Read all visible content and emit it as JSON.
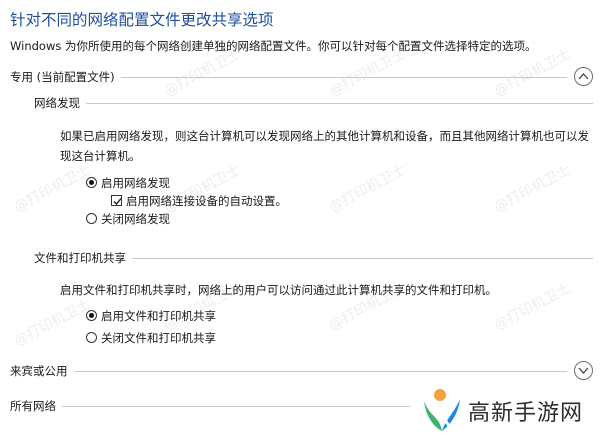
{
  "page": {
    "title": "针对不同的网络配置文件更改共享选项",
    "description": "Windows 为你所使用的每个网络创建单独的网络配置文件。你可以针对每个配置文件选择特定的选项。"
  },
  "sections": {
    "private": {
      "label": "专用 (当前配置文件)",
      "expanded": true,
      "chevron_icon": "chevron-up-icon",
      "network_discovery": {
        "label": "网络发现",
        "description": "如果已启用网络发现，则这台计算机可以发现网络上的其他计算机和设备，而且其他网络计算机也可以发现这台计算机。",
        "options": {
          "on": {
            "label": "启用网络发现",
            "selected": true
          },
          "auto_setup": {
            "label": "启用网络连接设备的自动设置。",
            "checked": true
          },
          "off": {
            "label": "关闭网络发现",
            "selected": false
          }
        }
      },
      "file_printer_sharing": {
        "label": "文件和打印机共享",
        "description": "启用文件和打印机共享时，网络上的用户可以访问通过此计算机共享的文件和打印机。",
        "options": {
          "on": {
            "label": "启用文件和打印机共享",
            "selected": true
          },
          "off": {
            "label": "关闭文件和打印机共享",
            "selected": false
          }
        }
      }
    },
    "guest_public": {
      "label": "来宾或公用",
      "expanded": false,
      "chevron_icon": "chevron-down-icon"
    },
    "all_networks": {
      "label": "所有网络"
    }
  },
  "watermark": {
    "text": "@打印机卫士"
  },
  "brand": {
    "name": "高新手游网",
    "logo_icon": "brand-logo-icon"
  }
}
